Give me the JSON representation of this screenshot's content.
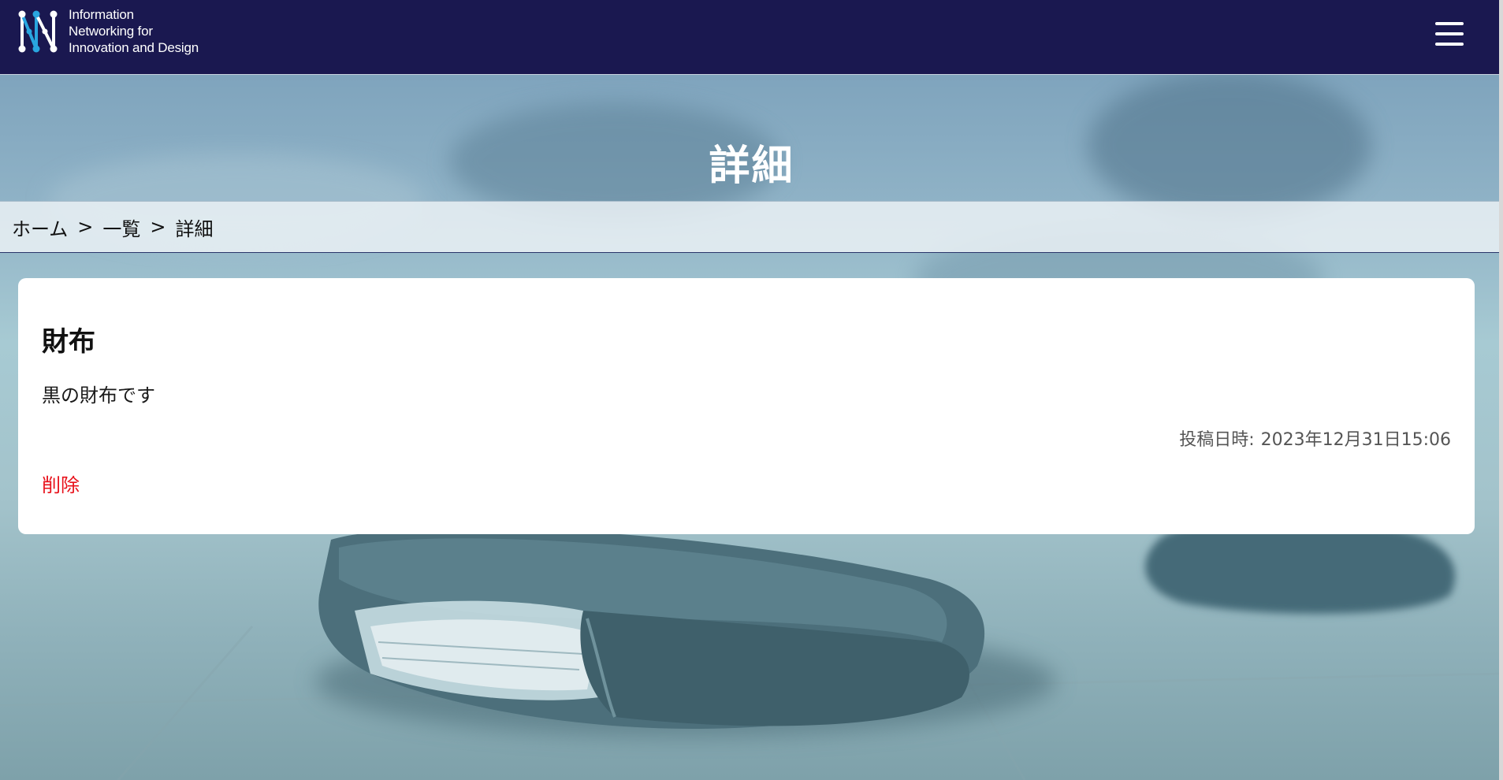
{
  "header": {
    "logo_lines": [
      "Information",
      "Networking for",
      "Innovation and Design"
    ],
    "menu_icon": "hamburger-menu-icon"
  },
  "page": {
    "title": "詳細"
  },
  "breadcrumb": {
    "home": "ホーム",
    "list": "一覧",
    "current": "詳細",
    "separator": ">"
  },
  "item": {
    "title": "財布",
    "description": "黒の財布です",
    "posted_label": "投稿日時:",
    "posted_value": "2023年12月31日15:06",
    "delete_label": "削除"
  },
  "colors": {
    "header_bg": "#1a1850",
    "delete_link": "#e8101a",
    "logo_accent": "#29a6e0"
  }
}
